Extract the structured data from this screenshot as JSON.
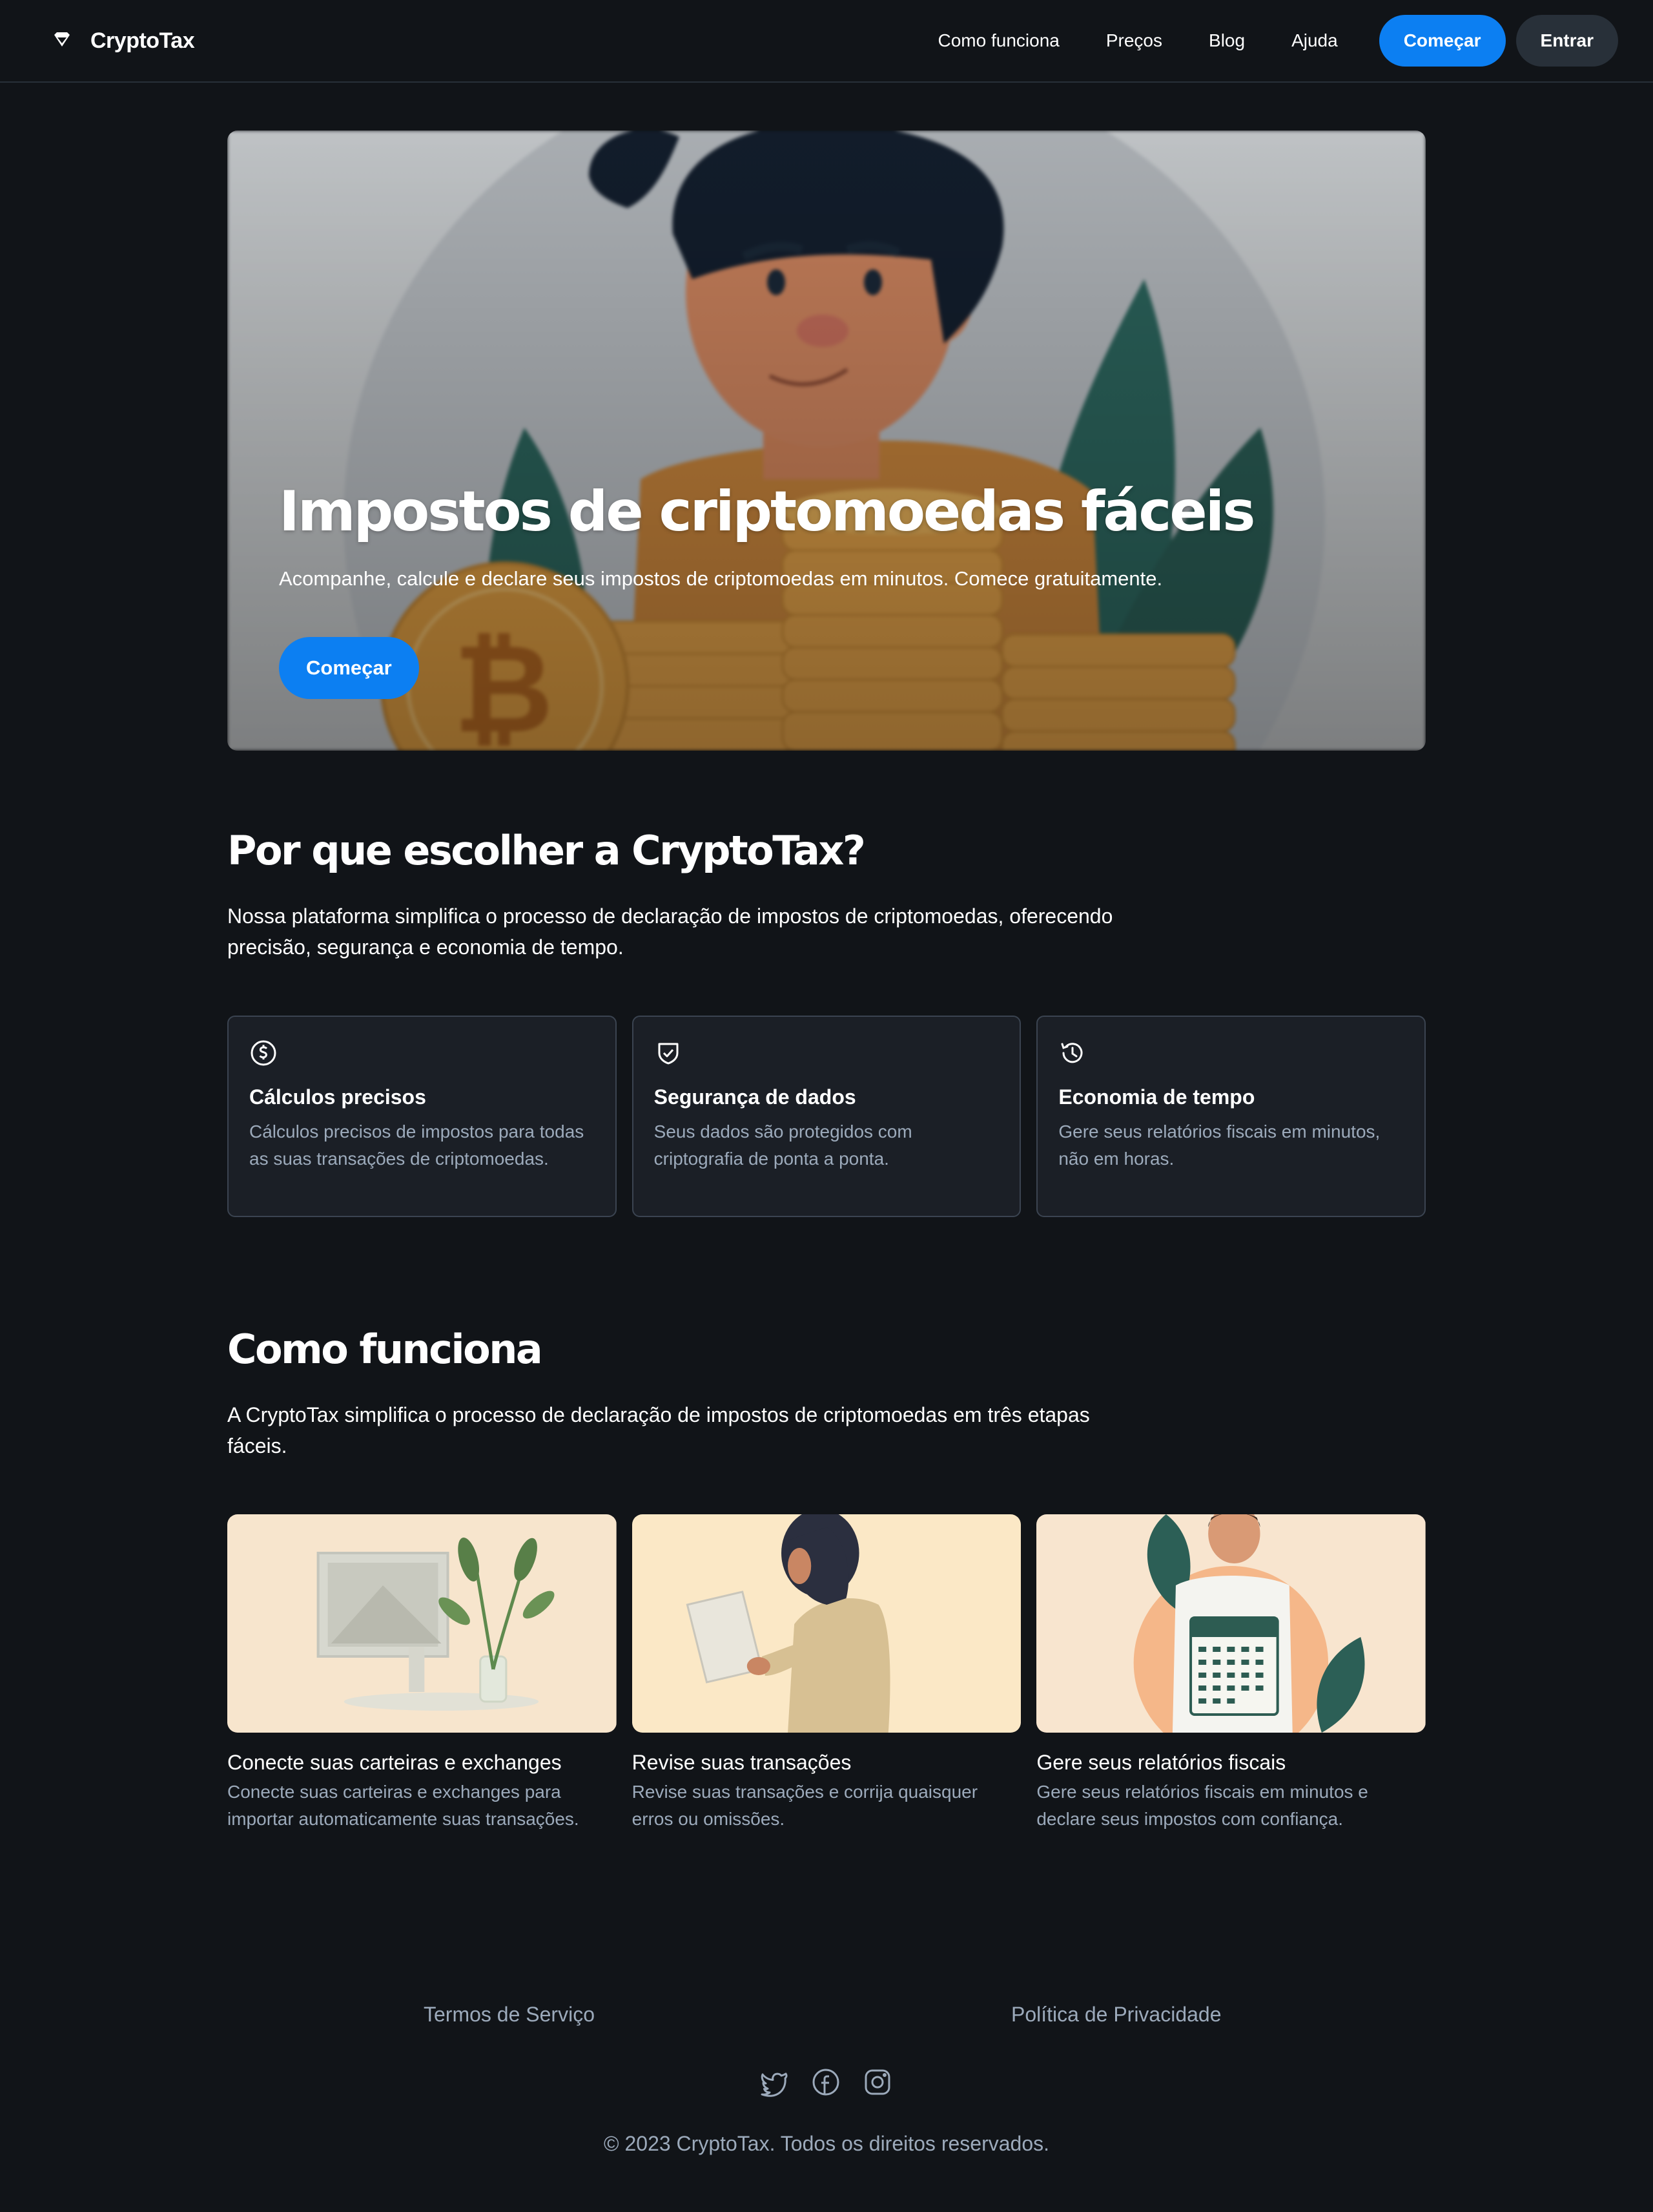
{
  "header": {
    "brand": "CryptoTax",
    "brand_icon": "diamond-logo-icon",
    "nav": [
      "Como funciona",
      "Preços",
      "Blog",
      "Ajuda"
    ],
    "start_button": "Começar",
    "login_button": "Entrar"
  },
  "hero": {
    "title": "Impostos de criptomoedas fáceis",
    "subtitle": "Acompanhe, calcule e declare seus impostos de criptomoedas em minutos. Comece gratuitamente.",
    "cta": "Começar"
  },
  "why": {
    "title": "Por que escolher a CryptoTax?",
    "text": "Nossa plataforma simplifica o processo de declaração de impostos de criptomoedas, oferecendo precisão, segurança e economia de tempo.",
    "features": [
      {
        "icon": "dollar-circle-icon",
        "title": "Cálculos precisos",
        "desc": "Cálculos precisos de impostos para todas as suas transações de criptomoedas."
      },
      {
        "icon": "shield-check-icon",
        "title": "Segurança de dados",
        "desc": "Seus dados são protegidos com criptografia de ponta a ponta."
      },
      {
        "icon": "clock-history-icon",
        "title": "Economia de tempo",
        "desc": "Gere seus relatórios fiscais em minutos, não em horas."
      }
    ]
  },
  "how": {
    "title": "Como funciona",
    "text": "A CryptoTax simplifica o processo de declaração de impostos de criptomoedas em três etapas fáceis.",
    "steps": [
      {
        "title": "Conecte suas carteiras e exchanges",
        "desc": "Conecte suas carteiras e exchanges para importar automaticamente suas transações."
      },
      {
        "title": "Revise suas transações",
        "desc": "Revise suas transações e corrija quaisquer erros ou omissões."
      },
      {
        "title": "Gere seus relatórios fiscais",
        "desc": "Gere seus relatórios fiscais em minutos e declare seus impostos com confiança."
      }
    ]
  },
  "footer": {
    "terms": "Termos de Serviço",
    "privacy": "Política de Privacidade",
    "social_icons": [
      "twitter-icon",
      "facebook-icon",
      "instagram-icon"
    ],
    "copyright": "© 2023 CryptoTax. Todos os direitos reservados."
  },
  "colors": {
    "background": "#111418",
    "primary": "#0c7ff2",
    "secondary_button": "#283039",
    "muted_text": "#9caabb",
    "card_border": "#3b4451"
  }
}
